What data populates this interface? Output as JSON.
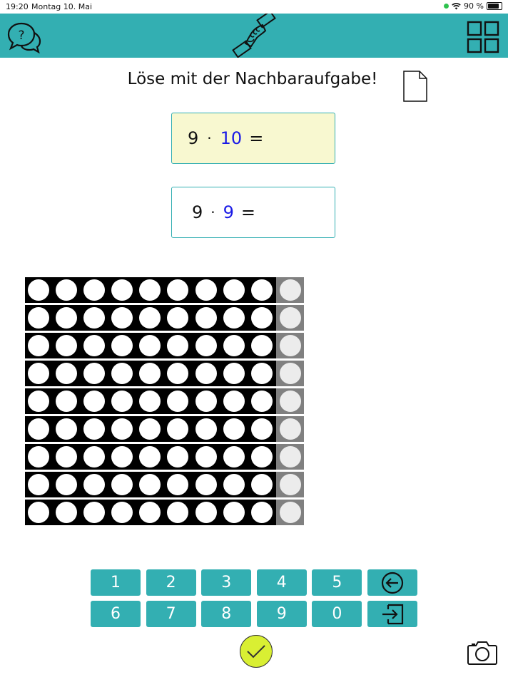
{
  "status": {
    "time": "19:20",
    "date": "Montag 10. Mai",
    "battery": "90 %"
  },
  "header": {
    "help_icon": "question-speech-icon",
    "logo_icon": "handshake-icon",
    "menu_icon": "grid-icon",
    "accent": "#33afb2"
  },
  "task": {
    "title": "Löse mit der Nachbaraufgabe!",
    "doc_icon": "document-icon"
  },
  "equations": [
    {
      "left": "9",
      "op": "·",
      "right": "10",
      "eq": "=",
      "bg": "#f8f8d0"
    },
    {
      "left": "9",
      "op": "·",
      "right": "9",
      "eq": "=",
      "bg": "#ffffff"
    }
  ],
  "dot_field": {
    "rows": 9,
    "black_dots_per_row": 9,
    "grey_dots_per_row": 1
  },
  "keypad": {
    "keys": [
      "1",
      "2",
      "3",
      "4",
      "5",
      "back",
      "6",
      "7",
      "8",
      "9",
      "0",
      "enter"
    ]
  },
  "actions": {
    "check_icon": "check-icon",
    "camera_icon": "camera-icon"
  }
}
